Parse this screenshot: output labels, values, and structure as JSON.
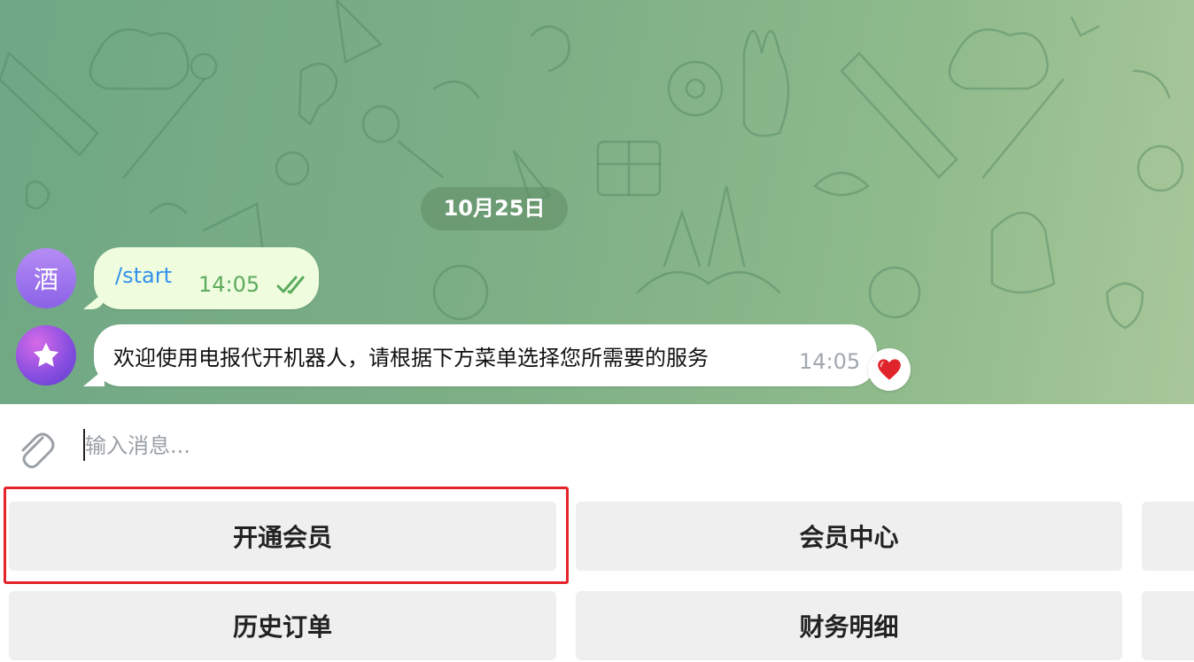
{
  "chat": {
    "date_separator": "10月25日",
    "messages": [
      {
        "sender_avatar_text": "酒",
        "text": "/start",
        "time": "14:05",
        "status": "read"
      },
      {
        "sender_avatar_icon": "star-icon",
        "text": "欢迎使用电报代开机器人，请根据下方菜单选择您所需要的服务",
        "time": "14:05",
        "reaction": "❤️"
      }
    ]
  },
  "composer": {
    "placeholder": "输入消息...",
    "attach_icon": "paperclip-icon"
  },
  "keyboard": {
    "rows": [
      [
        "开通会员",
        "会员中心",
        ""
      ],
      [
        "历史订单",
        "财务明细",
        ""
      ]
    ]
  },
  "colors": {
    "outgoing_bubble": "#effdde",
    "link_blue": "#3390ec",
    "read_ticks": "#5dab5f",
    "highlight_red": "#e5232b",
    "keyboard_button": "#efefef"
  }
}
